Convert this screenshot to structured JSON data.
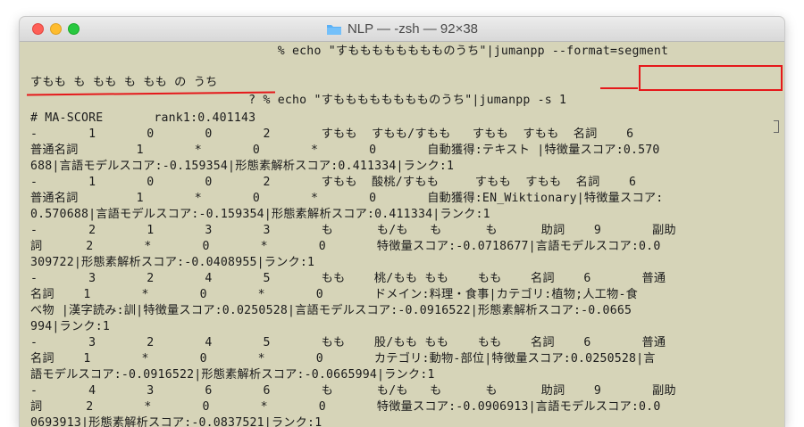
{
  "window": {
    "title": "NLP — -zsh — 92×38"
  },
  "terminal": {
    "lines": [
      "                                  % echo \"すもももももももものうち\"|jumanpp --format=segment",
      "すもも も もも も もも の うち",
      "                              ? % echo \"すもももももももものうち\"|jumanpp -s 1",
      "# MA-SCORE       rank1:0.401143",
      "-       1       0       0       2       すもも  すもも/すもも   すもも  すもも  名詞    6",
      "普通名詞        1       *       0       *       0       自動獲得:テキスト |特徴量スコア:0.570",
      "688|言語モデルスコア:-0.159354|形態素解析スコア:0.411334|ランク:1",
      "-       1       0       0       2       すもも  酸桃/すもも     すもも  すもも  名詞    6",
      "普通名詞        1       *       0       *       0       自動獲得:EN_Wiktionary|特徴量スコア:",
      "0.570688|言語モデルスコア:-0.159354|形態素解析スコア:0.411334|ランク:1",
      "-       2       1       3       3       も      も/も   も      も      助詞    9       副助",
      "詞      2       *       0       *       0       特徴量スコア:-0.0718677|言語モデルスコア:0.0",
      "309722|形態素解析スコア:-0.0408955|ランク:1",
      "-       3       2       4       5       もも    桃/もも もも    もも    名詞    6       普通",
      "名詞    1       *       0       *       0       ドメイン:料理・食事|カテゴリ:植物;人工物-食",
      "べ物 |漢字読み:訓|特徴量スコア:0.0250528|言語モデルスコア:-0.0916522|形態素解析スコア:-0.0665",
      "994|ランク:1",
      "-       3       2       4       5       もも    股/もも もも    もも    名詞    6       普通",
      "名詞    1       *       0       *       0       カテゴリ:動物-部位|特徴量スコア:0.0250528|言",
      "語モデルスコア:-0.0916522|形態素解析スコア:-0.0665994|ランク:1",
      "-       4       3       6       6       も      も/も   も      も      助詞    9       副助",
      "詞      2       *       0       *       0       特徴量スコア:-0.0906913|言語モデルスコア:0.0",
      "0693913|形態素解析スコア:-0.0837521|ランク:1"
    ]
  },
  "colors": {
    "terminal_bg": "#d6d4b8",
    "terminal_fg": "#1b1b1b",
    "annotation": "#e5181a"
  },
  "icons": {
    "title_icon": "folder-icon"
  }
}
